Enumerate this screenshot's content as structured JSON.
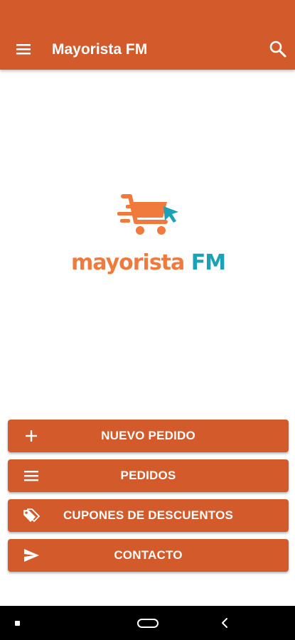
{
  "appbar": {
    "title": "Mayorista FM",
    "menu_icon": "menu-icon",
    "search_icon": "search-icon"
  },
  "logo": {
    "word1": "mayorista",
    "word2": "FM",
    "icon": "shopping-cart-cursor-icon"
  },
  "actions": [
    {
      "label": "NUEVO PEDIDO",
      "icon": "plus-icon"
    },
    {
      "label": "PEDIDOS",
      "icon": "list-icon"
    },
    {
      "label": "CUPONES DE DESCUENTOS",
      "icon": "tags-icon"
    },
    {
      "label": "CONTACTO",
      "icon": "send-icon"
    }
  ],
  "colors": {
    "primary": "#D35A2B",
    "logo_orange": "#F07A3C",
    "logo_teal": "#1BA2B8",
    "navbar": "#000000"
  },
  "system_nav": {
    "recents_icon": "recents-icon",
    "home_icon": "home-pill-icon",
    "back_icon": "back-chevron-icon"
  }
}
